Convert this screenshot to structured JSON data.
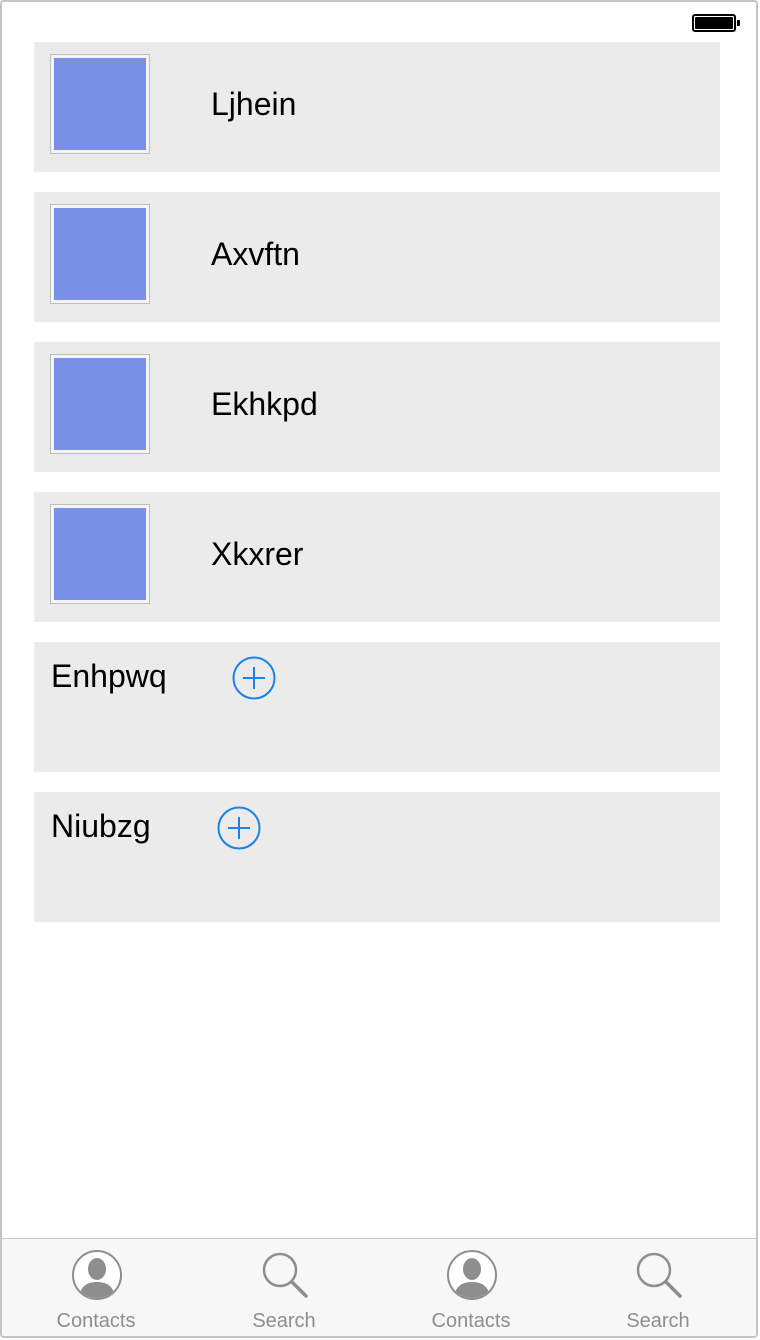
{
  "status_bar": {
    "battery_icon": "battery-full-icon"
  },
  "contacts": [
    {
      "name": "Ljhein",
      "thumb_color": "#7a8fe6"
    },
    {
      "name": "Axvftn",
      "thumb_color": "#7a8fe6"
    },
    {
      "name": "Ekhkpd",
      "thumb_color": "#7a8fe6"
    },
    {
      "name": "Xkxrer",
      "thumb_color": "#7a8fe6"
    }
  ],
  "addable": [
    {
      "name": "Enhpwq",
      "add_icon": "add-circle-icon"
    },
    {
      "name": "Niubzg",
      "add_icon": "add-circle-icon"
    }
  ],
  "colors": {
    "accent": "#1a82e8",
    "card_bg": "#ebebeb",
    "tab_label": "#8e8e8e"
  },
  "tabbar": {
    "tabs": [
      {
        "label": "Contacts",
        "icon": "contacts-icon"
      },
      {
        "label": "Search",
        "icon": "search-icon"
      },
      {
        "label": "Contacts",
        "icon": "contacts-icon"
      },
      {
        "label": "Search",
        "icon": "search-icon"
      }
    ]
  }
}
